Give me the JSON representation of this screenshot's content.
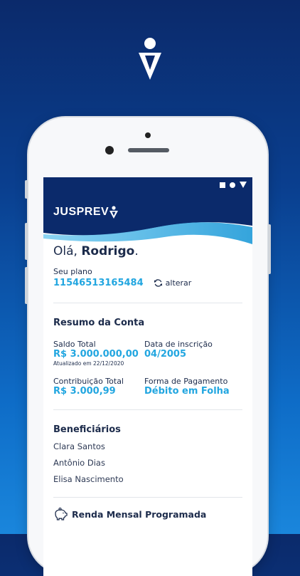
{
  "app": {
    "brand": "JUSPREV"
  },
  "greeting": {
    "prefix": "Olá, ",
    "name": "Rodrigo",
    "suffix": "."
  },
  "plan": {
    "label": "Seu plano",
    "number": "11546513165484",
    "change_label": "alterar"
  },
  "account_summary": {
    "title": "Resumo da Conta",
    "total_balance_label": "Saldo Total",
    "total_balance_value": "R$ 3.000.000,00",
    "updated_note": "Atualizado em 22/12/2020",
    "enrollment_label": "Data de inscrição",
    "enrollment_value": "04/2005",
    "total_contribution_label": "Contribuição Total",
    "total_contribution_value": "R$ 3.000,99",
    "payment_method_label": "Forma de Pagamento",
    "payment_method_value": "Débito em Folha"
  },
  "beneficiaries": {
    "title": "Beneficiários",
    "items": [
      "Clara Santos",
      "Antônio Dias",
      "Elisa Nascimento"
    ]
  },
  "monthly_income": {
    "title": "Renda Mensal Programada",
    "icon": "piggy-bank-icon"
  },
  "colors": {
    "navy": "#0b2a6b",
    "accent": "#22a6e0",
    "text": "#1c2b4b"
  }
}
